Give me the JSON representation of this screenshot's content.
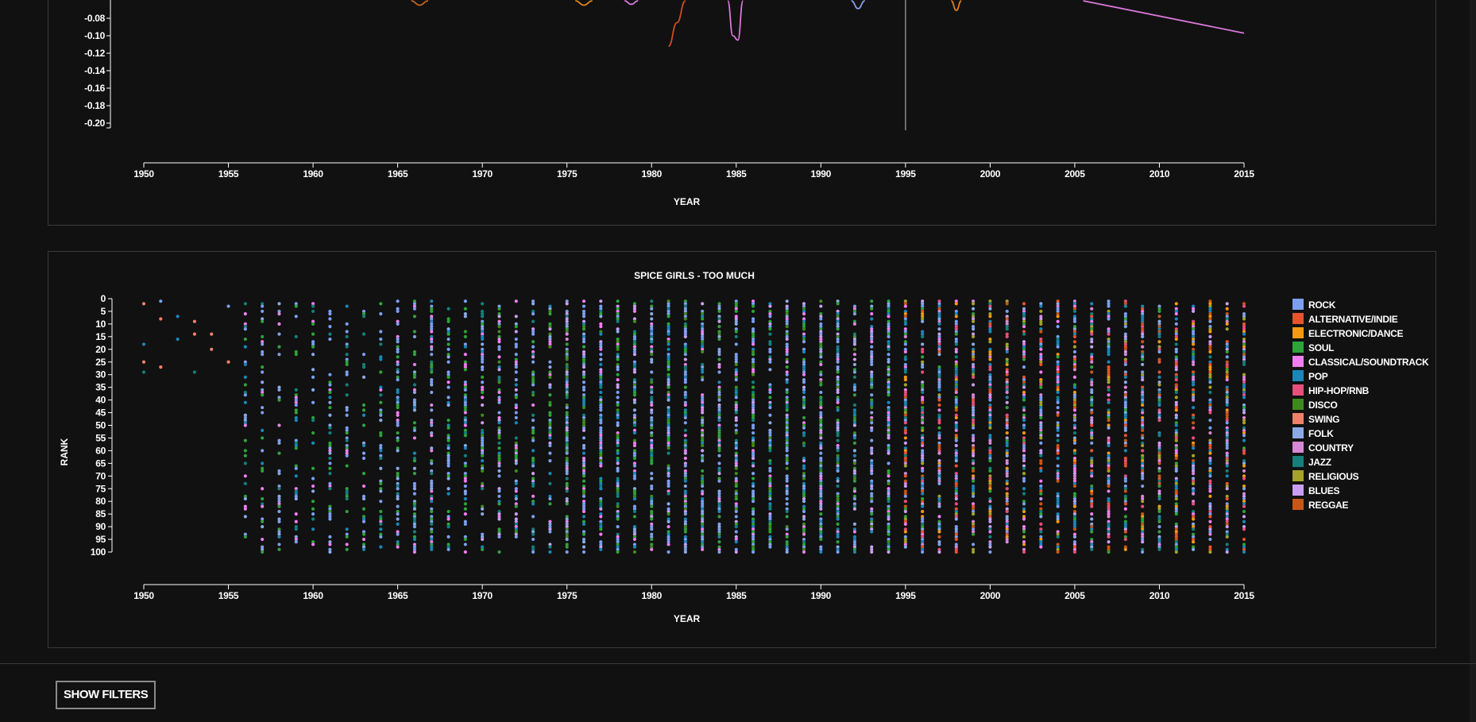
{
  "top_chart": {
    "ytick_labels": [
      "-0.08",
      "-0.10",
      "-0.12",
      "-0.14",
      "-0.16",
      "-0.18",
      "-0.20"
    ],
    "xtick_labels": [
      "1950",
      "1955",
      "1960",
      "1965",
      "1970",
      "1975",
      "1980",
      "1985",
      "1990",
      "1995",
      "2000",
      "2005",
      "2010",
      "2015"
    ],
    "xlabel": "YEAR"
  },
  "chart_data": [
    {
      "type": "line",
      "xlabel": "YEAR",
      "ylabel": "",
      "x_range": [
        1950,
        2015
      ],
      "y_visible_range": [
        -0.2,
        -0.06
      ],
      "series_colors": [
        "#c7651f",
        "#e08a1e",
        "#d978d9",
        "#d04a25",
        "#8c9ee6",
        "#e07d1e",
        "#d978d9"
      ],
      "curves": [
        {
          "x": [
            1965.8,
            1966.3,
            1966.8
          ],
          "y": [
            -0.06,
            -0.065,
            -0.06
          ],
          "color": "#c7651f"
        },
        {
          "x": [
            1975.5,
            1976.0,
            1976.5
          ],
          "y": [
            -0.06,
            -0.065,
            -0.06
          ],
          "color": "#e08a1e"
        },
        {
          "x": [
            1978.4,
            1978.8,
            1979.2
          ],
          "y": [
            -0.06,
            -0.064,
            -0.06
          ],
          "color": "#d978d9"
        },
        {
          "x": [
            1981.0,
            1981.5,
            1982.0
          ],
          "y": [
            -0.112,
            -0.085,
            -0.06
          ],
          "color": "#d04a25"
        },
        {
          "x": [
            1984.5,
            1984.8,
            1985.1,
            1985.4
          ],
          "y": [
            -0.06,
            -0.1,
            -0.105,
            -0.06
          ],
          "color": "#d978d9"
        },
        {
          "x": [
            1991.8,
            1992.2,
            1992.6
          ],
          "y": [
            -0.06,
            -0.069,
            -0.06
          ],
          "color": "#8c9ee6"
        },
        {
          "x": [
            1997.7,
            1998.0,
            1998.3
          ],
          "y": [
            -0.06,
            -0.071,
            -0.06
          ],
          "color": "#e07d1e"
        },
        {
          "x": [
            2005.5,
            2015.0
          ],
          "y": [
            -0.06,
            -0.097
          ],
          "color": "#d978d9"
        }
      ],
      "marker_line_x": 1995
    },
    {
      "type": "scatter",
      "title": "SPICE GIRLS - TOO MUCH",
      "xlabel": "YEAR",
      "ylabel": "RANK",
      "x_range": [
        1950,
        2015
      ],
      "ylim": [
        0,
        100
      ],
      "y_inverted": true,
      "xtick_labels": [
        "1950",
        "1955",
        "1960",
        "1965",
        "1970",
        "1975",
        "1980",
        "1985",
        "1990",
        "1995",
        "2000",
        "2005",
        "2010",
        "2015"
      ],
      "ytick_labels": [
        "0",
        "5",
        "10",
        "15",
        "20",
        "25",
        "30",
        "35",
        "40",
        "45",
        "50",
        "55",
        "60",
        "65",
        "70",
        "75",
        "80",
        "85",
        "90",
        "95",
        "100"
      ],
      "legend_position": "right",
      "legend": [
        {
          "label": "ROCK",
          "color": "#7b9ff0"
        },
        {
          "label": "ALTERNATIVE/INDIE",
          "color": "#e8532b"
        },
        {
          "label": "ELECTRONIC/DANCE",
          "color": "#f59a10"
        },
        {
          "label": "SOUL",
          "color": "#2ea33a"
        },
        {
          "label": "CLASSICAL/SOUNDTRACK",
          "color": "#f07ef0"
        },
        {
          "label": "POP",
          "color": "#1a87b8"
        },
        {
          "label": "HIP-HOP/RNB",
          "color": "#e84f7c"
        },
        {
          "label": "DISCO",
          "color": "#3f8a1c"
        },
        {
          "label": "SWING",
          "color": "#f0806a"
        },
        {
          "label": "FOLK",
          "color": "#8aaae6"
        },
        {
          "label": "COUNTRY",
          "color": "#d687d6"
        },
        {
          "label": "JAZZ",
          "color": "#13807c"
        },
        {
          "label": "RELIGIOUS",
          "color": "#a3a32a"
        },
        {
          "label": "BLUES",
          "color": "#c99ef2"
        },
        {
          "label": "REGGAE",
          "color": "#c75714"
        }
      ],
      "series_note_points": [
        {
          "year": 1950,
          "rank": 2,
          "genre": "SWING"
        },
        {
          "year": 1950,
          "rank": 18,
          "genre": "POP"
        },
        {
          "year": 1950,
          "rank": 25,
          "genre": "SWING"
        },
        {
          "year": 1950,
          "rank": 29,
          "genre": "JAZZ"
        },
        {
          "year": 1951,
          "rank": 1,
          "genre": "ROCK"
        },
        {
          "year": 1951,
          "rank": 8,
          "genre": "SWING"
        },
        {
          "year": 1951,
          "rank": 27,
          "genre": "SWING"
        },
        {
          "year": 1952,
          "rank": 7,
          "genre": "POP"
        },
        {
          "year": 1952,
          "rank": 16,
          "genre": "POP"
        },
        {
          "year": 1953,
          "rank": 9,
          "genre": "SWING"
        },
        {
          "year": 1953,
          "rank": 14,
          "genre": "SWING"
        },
        {
          "year": 1953,
          "rank": 29,
          "genre": "JAZZ"
        },
        {
          "year": 1954,
          "rank": 14,
          "genre": "SWING"
        },
        {
          "year": 1954,
          "rank": 20,
          "genre": "SWING"
        },
        {
          "year": 1955,
          "rank": 3,
          "genre": "ROCK"
        },
        {
          "year": 1955,
          "rank": 25,
          "genre": "SWING"
        }
      ]
    }
  ],
  "buttons": {
    "show_filters": "SHOW FILTERS"
  }
}
